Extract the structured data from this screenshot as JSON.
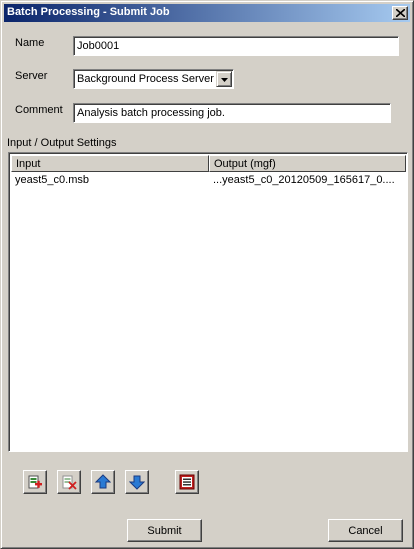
{
  "window": {
    "title": "Batch Processing - Submit Job"
  },
  "form": {
    "name_label": "Name",
    "name_value": "Job0001",
    "server_label": "Server",
    "server_value": "Background Process Server",
    "comment_label": "Comment",
    "comment_value": "Analysis batch processing job."
  },
  "io": {
    "section_label": "Input / Output Settings",
    "columns": [
      "Input",
      "Output (mgf)"
    ],
    "rows": [
      {
        "input": "yeast5_c0.msb",
        "output": "...yeast5_c0_20120509_165617_0...."
      }
    ]
  },
  "toolbar": {
    "icons": [
      "add-icon",
      "remove-icon",
      "move-up-icon",
      "move-down-icon",
      "properties-icon"
    ]
  },
  "buttons": {
    "submit": "Submit",
    "cancel": "Cancel"
  }
}
